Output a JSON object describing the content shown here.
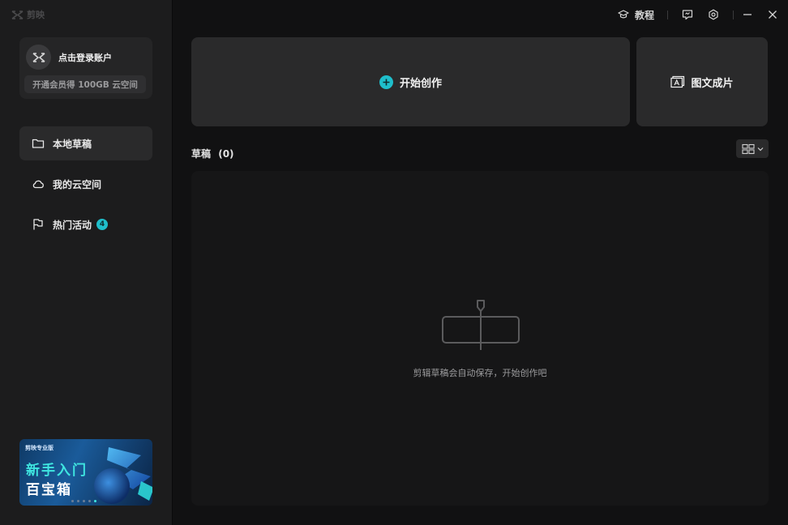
{
  "app": {
    "logo_text": "剪映"
  },
  "titlebar": {
    "tutorial_label": "教程",
    "icons": [
      "graduation-cap-icon",
      "feedback-icon",
      "settings-icon",
      "minimize-icon",
      "close-icon"
    ]
  },
  "account": {
    "login_label": "点击登录账户",
    "vip_offer": "开通会员得 100GB 云空间"
  },
  "sidebar": {
    "items": [
      {
        "label": "本地草稿",
        "icon": "folder-icon",
        "active": true
      },
      {
        "label": "我的云空间",
        "icon": "cloud-icon",
        "active": false
      },
      {
        "label": "热门活动",
        "icon": "flag-icon",
        "active": false,
        "badge": "4"
      }
    ]
  },
  "promo": {
    "brand": "剪映专业版",
    "title_line1": "新手入门",
    "title_line2": "百宝箱",
    "slides": 5,
    "active_slide": 5
  },
  "main": {
    "create_label": "开始创作",
    "image_text_label": "图文成片",
    "drafts_label": "草稿",
    "drafts_count": "(0)",
    "empty_text": "剪辑草稿会自动保存，开始创作吧"
  },
  "colors": {
    "accent": "#1fbecb",
    "sidebar_bg": "#1c1c1d",
    "card_bg": "#2a2a2b",
    "app_bg": "#111112"
  }
}
